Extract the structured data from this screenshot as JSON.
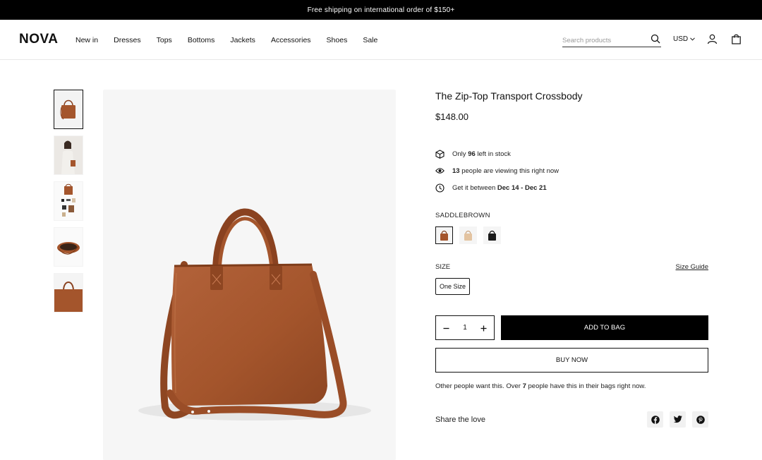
{
  "announcement": "Free shipping on international order of $150+",
  "header": {
    "logo": "NOVA",
    "nav": [
      "New in",
      "Dresses",
      "Tops",
      "Bottoms",
      "Jackets",
      "Accessories",
      "Shoes",
      "Sale"
    ],
    "search_placeholder": "Search products",
    "currency": "USD"
  },
  "gallery": {
    "thumbnails": [
      "bag-front",
      "model-with-bag",
      "bag-contents",
      "bag-interior",
      "bag-detail"
    ],
    "active_index": 0
  },
  "product": {
    "title": "The Zip-Top Transport Crossbody",
    "price": "$148.00",
    "stock": {
      "prefix": "Only ",
      "count": "96",
      "suffix": " left in stock"
    },
    "viewers": {
      "count": "13",
      "suffix": " people are viewing this right now"
    },
    "delivery": {
      "prefix": "Get it between ",
      "range": "Dec 14 - Dec 21"
    },
    "color_label": "SADDLEBROWN",
    "colors": [
      {
        "name": "saddlebrown",
        "hex": "#a0522d"
      },
      {
        "name": "tan",
        "hex": "#e3c3a0"
      },
      {
        "name": "black",
        "hex": "#1a1a1a"
      }
    ],
    "size_label": "SIZE",
    "size_guide": "Size Guide",
    "size_option": "One Size",
    "quantity": "1",
    "add_to_bag": "ADD TO BAG",
    "buy_now": "BUY NOW",
    "social": {
      "prefix": "Other people want this. Over ",
      "count": "7",
      "suffix": " people have this in their bags right now."
    },
    "share_label": "Share the love"
  },
  "colors": {
    "bag": "#a4552c",
    "bag_dark": "#7e3c1a",
    "accent": "#000000"
  }
}
